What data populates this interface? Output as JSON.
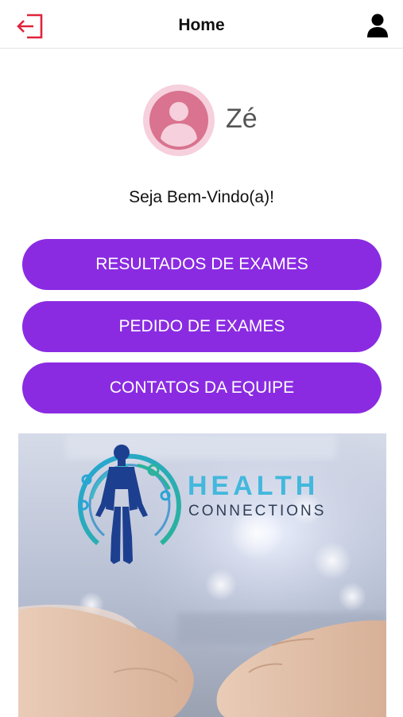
{
  "header": {
    "title": "Home",
    "logout_icon": "logout-icon",
    "profile_icon": "user-icon"
  },
  "profile": {
    "name": "Zé",
    "welcome": "Seja Bem-Vindo(a)!",
    "avatar_icon": "avatar-icon"
  },
  "menu": {
    "buttons": [
      {
        "label": "RESULTADOS DE EXAMES"
      },
      {
        "label": "PEDIDO DE EXAMES"
      },
      {
        "label": "CONTATOS DA EQUIPE"
      }
    ]
  },
  "banner": {
    "logo_word_1": "HEALTH",
    "logo_word_2": "CONNECTIONS"
  },
  "colors": {
    "accent": "#8a2be2",
    "logout": "#e0243c",
    "avatar_bg": "#f6d0dc",
    "avatar_fg": "#d9738f"
  }
}
